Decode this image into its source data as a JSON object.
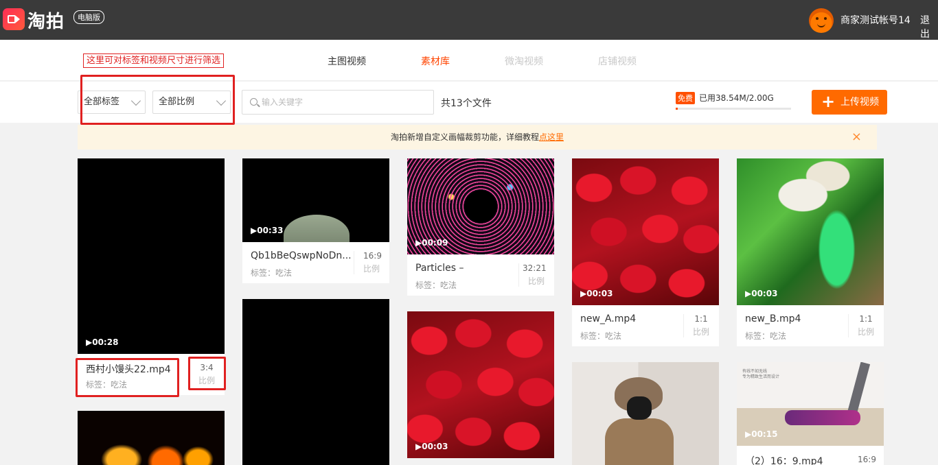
{
  "header": {
    "logo_text": "淘拍",
    "logo_badge": "电脑版",
    "account_name": "商家测试帐号14",
    "logout_label": "退出"
  },
  "annotation_hint": "这里可对标签和视频尺寸进行筛选",
  "nav": {
    "tabs": [
      {
        "label": "主图视频",
        "state": "normal"
      },
      {
        "label": "素材库",
        "state": "active"
      },
      {
        "label": "微淘视频",
        "state": "disabled"
      },
      {
        "label": "店铺视频",
        "state": "disabled"
      }
    ]
  },
  "filters": {
    "tag_select": "全部标签",
    "ratio_select": "全部比例",
    "search_placeholder": "输入关键字",
    "file_count": "共13个文件"
  },
  "storage": {
    "free_tag": "免费",
    "usage_text": "已用38.54M/2.00G",
    "used_fraction": 0.019
  },
  "upload": {
    "plus": "+",
    "label": "上传视频"
  },
  "notice": {
    "text": "淘拍新增自定义画幅裁剪功能，详细教程",
    "link": "点这里",
    "close": "×"
  },
  "videos": [
    {
      "duration": "▶00:28",
      "name": "西村小馒头22.mp4",
      "tag": "标签：吃法",
      "ratio": "3:4",
      "ratio_label": "比例"
    },
    {
      "duration": "▶00:33",
      "name": "Qb1bBeQswpNoDn...",
      "tag": "标签：吃法",
      "ratio": "16:9",
      "ratio_label": "比例"
    },
    {
      "duration": "▶00:09",
      "name": "Particles –",
      "tag": "标签：吃法",
      "ratio": "32:21",
      "ratio_label": "比例"
    },
    {
      "duration": "▶00:03",
      "name": "new_A.mp4",
      "tag": "标签：吃法",
      "ratio": "1:1",
      "ratio_label": "比例"
    },
    {
      "duration": "▶00:03",
      "name": "new_B.mp4",
      "tag": "标签：吃法",
      "ratio": "1:1",
      "ratio_label": "比例"
    },
    {
      "duration": "▶00:03"
    },
    {
      "duration": "▶00:15",
      "name": "（2）16：9.mp4",
      "ratio": "16:9",
      "overlay_caption_1": "有线不如无线",
      "overlay_caption_2": "专为精致生活而设计"
    }
  ],
  "colors": {
    "accent": "#ff6a00",
    "active_tab": "#ff4400",
    "annotation_red": "#e02020",
    "topbar": "#3a3a3a",
    "notice_bg": "#fdf5e3"
  }
}
